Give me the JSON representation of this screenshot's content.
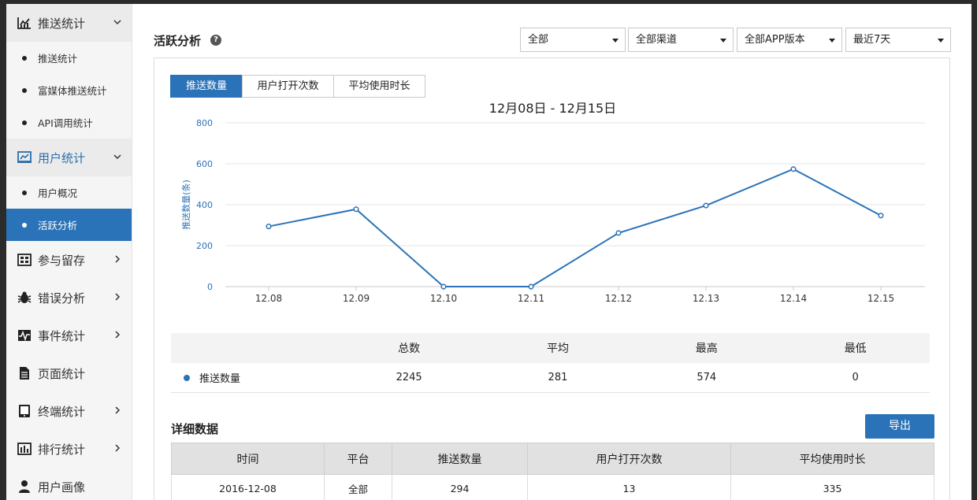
{
  "sidebar": {
    "groups": [
      {
        "label": "推送统计",
        "icon": "line-chart-icon",
        "subs": [
          {
            "label": "推送统计"
          },
          {
            "label": "富媒体推送统计"
          },
          {
            "label": "API调用统计"
          }
        ]
      },
      {
        "label": "用户统计",
        "icon": "user-chart-icon",
        "subs": [
          {
            "label": "用户概况"
          },
          {
            "label": "活跃分析"
          }
        ]
      },
      {
        "label": "参与留存",
        "icon": "calendar-grid-icon"
      },
      {
        "label": "错误分析",
        "icon": "bug-icon"
      },
      {
        "label": "事件统计",
        "icon": "pulse-icon"
      },
      {
        "label": "页面统计",
        "icon": "document-icon"
      },
      {
        "label": "终端统计",
        "icon": "device-icon"
      },
      {
        "label": "排行统计",
        "icon": "bar-rank-icon"
      },
      {
        "label": "用户画像",
        "icon": "user-icon"
      }
    ]
  },
  "header": {
    "title": "活跃分析",
    "help": "?",
    "filters": [
      "全部",
      "全部渠道",
      "全部APP版本",
      "最近7天"
    ]
  },
  "tabs": [
    "推送数量",
    "用户打开次数",
    "平均使用时长"
  ],
  "chart_data": {
    "type": "line",
    "title": "12月08日 - 12月15日",
    "ylabel": "推送数量(条)",
    "xlabel": "",
    "categories": [
      "12.08",
      "12.09",
      "12.10",
      "12.11",
      "12.12",
      "12.13",
      "12.14",
      "12.15"
    ],
    "series": [
      {
        "name": "推送数量",
        "values": [
          294,
          378,
          0,
          0,
          262,
          396,
          574,
          347
        ]
      }
    ],
    "yticks": [
      0,
      200,
      400,
      600,
      800
    ],
    "ylim": [
      0,
      800
    ],
    "grid": true,
    "color": "#2b73b8"
  },
  "stats": {
    "headers": [
      "总数",
      "平均",
      "最高",
      "最低"
    ],
    "row": {
      "name": "推送数量",
      "values": [
        "2245",
        "281",
        "574",
        "0"
      ]
    }
  },
  "detail": {
    "title": "详细数据",
    "export_label": "导出",
    "headers": [
      "时间",
      "平台",
      "推送数量",
      "用户打开次数",
      "平均使用时长"
    ],
    "rows": [
      [
        "2016-12-08",
        "全部",
        "294",
        "13",
        "335"
      ]
    ]
  }
}
